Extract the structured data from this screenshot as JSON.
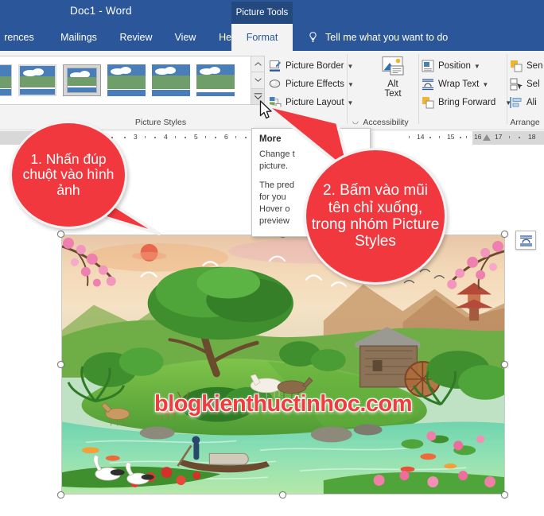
{
  "titlebar": {
    "document_title": "Doc1  -  Word",
    "contextual_tab": "Picture Tools"
  },
  "tabs": [
    {
      "label": "rences",
      "active": false
    },
    {
      "label": "Mailings",
      "active": false
    },
    {
      "label": "Review",
      "active": false
    },
    {
      "label": "View",
      "active": false
    },
    {
      "label": "Help",
      "active": false
    },
    {
      "label": "Format",
      "active": true
    }
  ],
  "tellme": {
    "label": "Tell me what you want to do",
    "icon": "lightbulb-icon"
  },
  "ribbon": {
    "groups": [
      {
        "name": "Picture Styles",
        "label": "Picture Styles"
      },
      {
        "name": "Accessibility",
        "label": "Accessibility"
      },
      {
        "name": "Arrange",
        "label": "Arrange"
      }
    ],
    "picture_styles": {
      "gallery_thumbnail_count": 6,
      "selected_index": 2,
      "scroll_up": "scroll-up-arrow",
      "scroll_down": "scroll-down-arrow",
      "more": "more-styles-arrow"
    },
    "commands": [
      {
        "label": "Picture Border",
        "icon": "picture-border-icon",
        "has_caret": true
      },
      {
        "label": "Picture Effects",
        "icon": "picture-effects-icon",
        "has_caret": true
      },
      {
        "label": "Picture Layout",
        "icon": "picture-layout-icon",
        "has_caret": true
      },
      {
        "label": "Position",
        "icon": "position-icon",
        "has_caret": true
      },
      {
        "label": "Wrap Text",
        "icon": "wrap-text-icon",
        "has_caret": true
      },
      {
        "label": "Bring Forward",
        "icon": "bring-forward-icon",
        "has_caret": true
      },
      {
        "label": "Sen",
        "icon": "send-backward-icon",
        "has_caret": false
      },
      {
        "label": "Sel",
        "icon": "selection-pane-icon",
        "has_caret": false
      },
      {
        "label": "Ali",
        "icon": "align-icon",
        "has_caret": false
      }
    ],
    "alt_text": {
      "line1": "Alt",
      "line2": "Text",
      "icon": "alt-text-icon"
    }
  },
  "ruler": {
    "left_numbers": [
      "3",
      "4",
      "5",
      "6"
    ],
    "right_numbers": [
      "14",
      "15",
      "16",
      "17",
      "18"
    ],
    "indent_marker": "hanging-indent-marker"
  },
  "tooltip": {
    "title": "More",
    "lines": [
      "Change t",
      "picture.",
      "The pred",
      "for you",
      "Hover o",
      "preview"
    ]
  },
  "document": {
    "image": {
      "alt": "landscape painting with lake, island, trees, mill house and pagoda",
      "watermark": "blogkienthuctinhoc.com",
      "selected": true,
      "handle_count": 8
    },
    "layout_options": {
      "name": "Layout Options",
      "icon": "layout-options-icon"
    }
  },
  "callouts": [
    {
      "id": "callout1",
      "text": "1. Nhấn đúp chuột vào hình ảnh",
      "color": "#f0383e"
    },
    {
      "id": "callout2",
      "text": "2. Bấm vào mũi tên chỉ xuống, trong nhóm Picture Styles",
      "color": "#f0383e"
    }
  ],
  "cursor": {
    "name": "mouse-pointer"
  },
  "colors": {
    "word_blue": "#2b579a",
    "ribbon_bg": "#f3f3f3",
    "callout_red": "#f0383e",
    "watermark_red": "#ef3d3d"
  }
}
